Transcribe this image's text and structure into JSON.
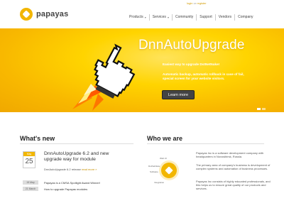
{
  "header": {
    "logo_text": "papayas",
    "login": {
      "link": "login",
      "separator": "or",
      "register": "register"
    },
    "nav": [
      {
        "label": "Products",
        "has_caret": true
      },
      {
        "label": "Services",
        "has_caret": true
      },
      {
        "label": "Community",
        "has_caret": false
      },
      {
        "label": "Support",
        "has_caret": false
      },
      {
        "label": "Vendors",
        "has_caret": false
      },
      {
        "label": "Company",
        "has_caret": false
      }
    ]
  },
  "banner": {
    "title": "DnnAutoUpgrade",
    "subtitle": "Easiest way to upgrade DotNetNuke!",
    "description": "Automatic backup, automatic rollback in case of fail, special screen for your website visitors.",
    "button": "Learn more",
    "slides": 2,
    "active_slide": 1
  },
  "whats_new": {
    "title": "What's new",
    "featured": {
      "month": "May",
      "day": "25",
      "title": "DnnAutoUpgrade 6.2 and new upgrade way for module",
      "subtitle": "DnnAutoUpgrade 6.2 release",
      "more": "read more »"
    },
    "items": [
      {
        "date": "15 May",
        "text": "Papayas is a CMSA Spotlight Award Winner!"
      },
      {
        "date": "21 March",
        "text": "How to upgrade Papayas modules"
      }
    ]
  },
  "who_we_are": {
    "title": "Who we are",
    "map_labels": [
      "Web.UI",
      "DotNetNuke",
      "Software",
      "Integration"
    ],
    "paragraphs": [
      "Papayas Inc is a software development company with headquarters in Novosibirsk, Russia.",
      "The primary area of company's business is development of complex systems and automation of business processes.",
      "Papayas Inc consists of highly educated professionals, and this helps us to ensure great quality of our products and services."
    ]
  },
  "colors": {
    "brand_yellow": "#f2b600",
    "banner_yellow": "#ffd400",
    "button_dark": "#444444"
  }
}
